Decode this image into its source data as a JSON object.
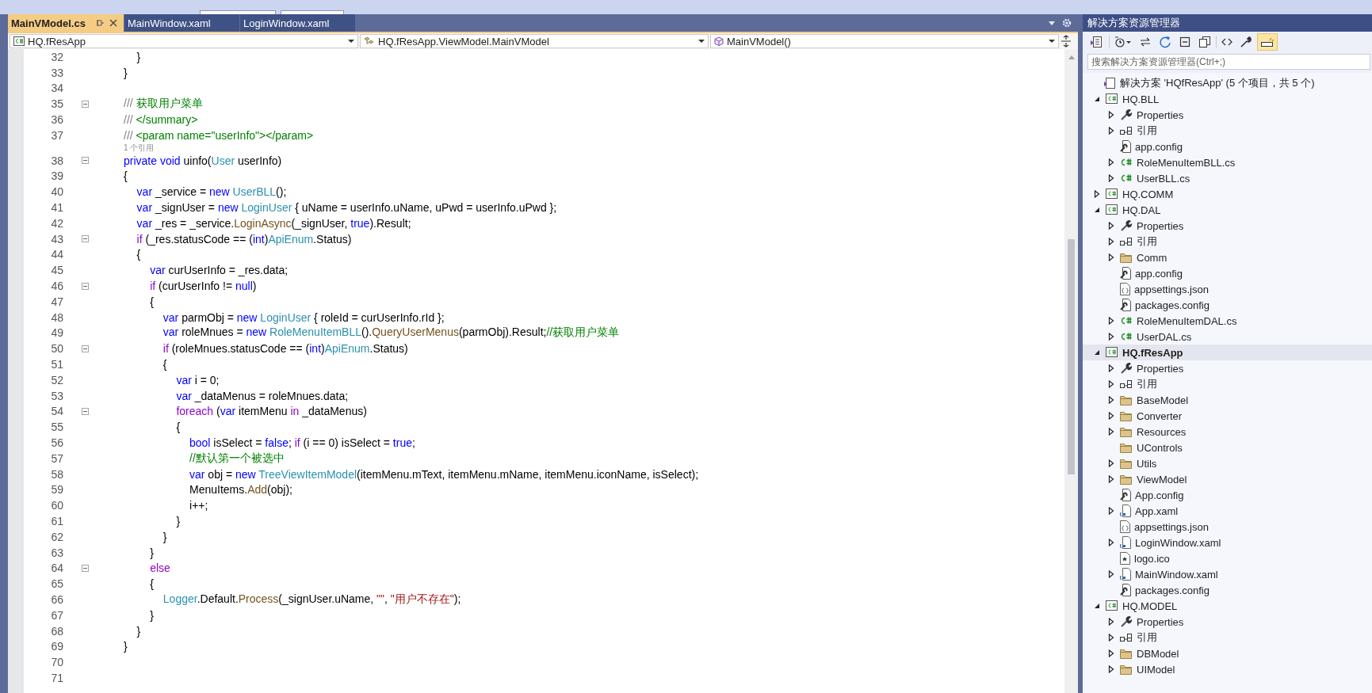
{
  "editor_tabs": [
    {
      "label": "MainVModel.cs",
      "selected": true,
      "pinned": true
    },
    {
      "label": "MainWindow.xaml",
      "selected": false,
      "pinned": false
    },
    {
      "label": "LoginWindow.xaml",
      "selected": false,
      "pinned": false
    }
  ],
  "navigation": {
    "project": "HQ.fResApp",
    "type": "HQ.fResApp.ViewModel.MainVModel",
    "member": "MainVModel()"
  },
  "code_lines": [
    {
      "number": "32",
      "foldable": false,
      "tokens": [
        {
          "kind": "plain",
          "text": "\t}"
        }
      ]
    },
    {
      "number": "33",
      "foldable": false,
      "tokens": [
        {
          "kind": "plain",
          "text": "}"
        }
      ]
    },
    {
      "number": "34",
      "foldable": false
    },
    {
      "number": "35",
      "foldable": true,
      "tokens": [
        {
          "kind": "doc",
          "text": "///"
        },
        {
          "kind": "comment",
          "text": " 获取用户菜单"
        }
      ]
    },
    {
      "number": "36",
      "foldable": false,
      "tokens": [
        {
          "kind": "doc",
          "text": "///"
        },
        {
          "kind": "comment",
          "text": " </summary>"
        }
      ]
    },
    {
      "number": "37",
      "foldable": false,
      "tokens": [
        {
          "kind": "doc",
          "text": "///"
        },
        {
          "kind": "comment",
          "text": " <param name=\"userInfo\"></param>"
        }
      ]
    },
    {
      "kind": "hint",
      "text": "1 个引用"
    },
    {
      "number": "38",
      "foldable": true,
      "tokens": [
        {
          "kind": "kw",
          "text": "private void"
        },
        {
          "kind": "plain",
          "text": " uinfo("
        },
        {
          "kind": "type",
          "text": "User"
        },
        {
          "kind": "plain",
          "text": " userInfo)"
        }
      ]
    },
    {
      "number": "39",
      "foldable": false,
      "tokens": [
        {
          "kind": "plain",
          "text": "{"
        }
      ]
    },
    {
      "number": "40",
      "foldable": false,
      "tokens": [
        {
          "kind": "kw",
          "text": "\tvar"
        },
        {
          "kind": "plain",
          "text": " _service = "
        },
        {
          "kind": "kw",
          "text": "new"
        },
        {
          "kind": "type",
          "text": " UserBLL"
        },
        {
          "kind": "plain",
          "text": "();"
        }
      ]
    },
    {
      "number": "41",
      "foldable": false,
      "tokens": [
        {
          "kind": "kw",
          "text": "\tvar"
        },
        {
          "kind": "plain",
          "text": " _signUser = "
        },
        {
          "kind": "kw",
          "text": "new"
        },
        {
          "kind": "type",
          "text": " LoginUser"
        },
        {
          "kind": "plain",
          "text": " { uName = userInfo.uName, uPwd = userInfo.uPwd };"
        }
      ]
    },
    {
      "number": "42",
      "foldable": false,
      "tokens": [
        {
          "kind": "kw",
          "text": "\tvar"
        },
        {
          "kind": "plain",
          "text": " _res = _service."
        },
        {
          "kind": "method",
          "text": "LoginAsync"
        },
        {
          "kind": "plain",
          "text": "(_signUser, "
        },
        {
          "kind": "kw",
          "text": "true"
        },
        {
          "kind": "plain",
          "text": ").Result;"
        }
      ]
    },
    {
      "number": "43",
      "foldable": true,
      "tokens": [
        {
          "kind": "ctl",
          "text": "\tif"
        },
        {
          "kind": "plain",
          "text": " (_res.statusCode == ("
        },
        {
          "kind": "kw",
          "text": "int"
        },
        {
          "kind": "plain",
          "text": ")"
        },
        {
          "kind": "type",
          "text": "ApiEnum"
        },
        {
          "kind": "plain",
          "text": ".Status)"
        }
      ]
    },
    {
      "number": "44",
      "foldable": false,
      "tokens": [
        {
          "kind": "plain",
          "text": "\t{"
        }
      ]
    },
    {
      "number": "45",
      "foldable": false,
      "tokens": [
        {
          "kind": "kw",
          "text": "\t\tvar"
        },
        {
          "kind": "plain",
          "text": " curUserInfo = _res.data;"
        }
      ]
    },
    {
      "number": "46",
      "foldable": true,
      "tokens": [
        {
          "kind": "ctl",
          "text": "\t\tif"
        },
        {
          "kind": "plain",
          "text": " (curUserInfo != "
        },
        {
          "kind": "kw",
          "text": "null"
        },
        {
          "kind": "plain",
          "text": ")"
        }
      ]
    },
    {
      "number": "47",
      "foldable": false,
      "tokens": [
        {
          "kind": "plain",
          "text": "\t\t{"
        }
      ]
    },
    {
      "number": "48",
      "foldable": false,
      "tokens": [
        {
          "kind": "kw",
          "text": "\t\t\tvar"
        },
        {
          "kind": "plain",
          "text": " parmObj = "
        },
        {
          "kind": "kw",
          "text": "new"
        },
        {
          "kind": "type",
          "text": " LoginUser"
        },
        {
          "kind": "plain",
          "text": " { roleId = curUserInfo.rId };"
        }
      ]
    },
    {
      "number": "49",
      "foldable": false,
      "tokens": [
        {
          "kind": "kw",
          "text": "\t\t\tvar"
        },
        {
          "kind": "plain",
          "text": " roleMnues = "
        },
        {
          "kind": "kw",
          "text": "new"
        },
        {
          "kind": "type",
          "text": " RoleMenuItemBLL"
        },
        {
          "kind": "plain",
          "text": "()."
        },
        {
          "kind": "method",
          "text": "QueryUserMenus"
        },
        {
          "kind": "plain",
          "text": "(parmObj).Result;"
        },
        {
          "kind": "comment",
          "text": "//获取用户菜单"
        }
      ]
    },
    {
      "number": "50",
      "foldable": true,
      "tokens": [
        {
          "kind": "ctl",
          "text": "\t\t\tif"
        },
        {
          "kind": "plain",
          "text": " (roleMnues.statusCode == ("
        },
        {
          "kind": "kw",
          "text": "int"
        },
        {
          "kind": "plain",
          "text": ")"
        },
        {
          "kind": "type",
          "text": "ApiEnum"
        },
        {
          "kind": "plain",
          "text": ".Status)"
        }
      ]
    },
    {
      "number": "51",
      "foldable": false,
      "tokens": [
        {
          "kind": "plain",
          "text": "\t\t\t{"
        }
      ]
    },
    {
      "number": "52",
      "foldable": false,
      "tokens": [
        {
          "kind": "kw",
          "text": "\t\t\t\tvar"
        },
        {
          "kind": "plain",
          "text": " i = 0;"
        }
      ]
    },
    {
      "number": "53",
      "foldable": false,
      "tokens": [
        {
          "kind": "kw",
          "text": "\t\t\t\tvar"
        },
        {
          "kind": "plain",
          "text": " _dataMenus = roleMnues.data;"
        }
      ]
    },
    {
      "number": "54",
      "foldable": true,
      "tokens": [
        {
          "kind": "ctl",
          "text": "\t\t\t\tforeach"
        },
        {
          "kind": "plain",
          "text": " ("
        },
        {
          "kind": "kw",
          "text": "var"
        },
        {
          "kind": "plain",
          "text": " itemMenu "
        },
        {
          "kind": "ctl",
          "text": "in"
        },
        {
          "kind": "plain",
          "text": " _dataMenus)"
        }
      ]
    },
    {
      "number": "55",
      "foldable": false,
      "tokens": [
        {
          "kind": "plain",
          "text": "\t\t\t\t{"
        }
      ]
    },
    {
      "number": "56",
      "foldable": false,
      "tokens": [
        {
          "kind": "kw",
          "text": "\t\t\t\t\tbool"
        },
        {
          "kind": "plain",
          "text": " isSelect = "
        },
        {
          "kind": "kw",
          "text": "false"
        },
        {
          "kind": "plain",
          "text": "; "
        },
        {
          "kind": "ctl",
          "text": "if"
        },
        {
          "kind": "plain",
          "text": " (i == 0) isSelect = "
        },
        {
          "kind": "kw",
          "text": "true"
        },
        {
          "kind": "plain",
          "text": ";"
        }
      ]
    },
    {
      "number": "57",
      "foldable": false,
      "tokens": [
        {
          "kind": "comment",
          "text": "\t\t\t\t\t//默认第一个被选中"
        }
      ]
    },
    {
      "number": "58",
      "foldable": false,
      "tokens": [
        {
          "kind": "kw",
          "text": "\t\t\t\t\tvar"
        },
        {
          "kind": "plain",
          "text": " obj = "
        },
        {
          "kind": "kw",
          "text": "new"
        },
        {
          "kind": "type",
          "text": " TreeViewItemModel"
        },
        {
          "kind": "plain",
          "text": "(itemMenu.mText, itemMenu.mName, itemMenu.iconName, isSelect);"
        }
      ]
    },
    {
      "number": "59",
      "foldable": false,
      "tokens": [
        {
          "kind": "plain",
          "text": "\t\t\t\t\tMenuItems."
        },
        {
          "kind": "method",
          "text": "Add"
        },
        {
          "kind": "plain",
          "text": "(obj);"
        }
      ]
    },
    {
      "number": "60",
      "foldable": false,
      "tokens": [
        {
          "kind": "plain",
          "text": "\t\t\t\t\ti++;"
        }
      ]
    },
    {
      "number": "61",
      "foldable": false,
      "tokens": [
        {
          "kind": "plain",
          "text": "\t\t\t\t}"
        }
      ]
    },
    {
      "number": "62",
      "foldable": false,
      "tokens": [
        {
          "kind": "plain",
          "text": "\t\t\t}"
        }
      ]
    },
    {
      "number": "63",
      "foldable": false,
      "tokens": [
        {
          "kind": "plain",
          "text": "\t\t}"
        }
      ]
    },
    {
      "number": "64",
      "foldable": true,
      "tokens": [
        {
          "kind": "ctl",
          "text": "\t\telse"
        }
      ]
    },
    {
      "number": "65",
      "foldable": false,
      "tokens": [
        {
          "kind": "plain",
          "text": "\t\t{"
        }
      ]
    },
    {
      "number": "66",
      "foldable": false,
      "tokens": [
        {
          "kind": "type",
          "text": "\t\t\tLogger"
        },
        {
          "kind": "plain",
          "text": ".Default."
        },
        {
          "kind": "method",
          "text": "Process"
        },
        {
          "kind": "plain",
          "text": "(_signUser.uName, "
        },
        {
          "kind": "string",
          "text": "\"\""
        },
        {
          "kind": "plain",
          "text": ", "
        },
        {
          "kind": "string",
          "text": "\"用户不存在\""
        },
        {
          "kind": "plain",
          "text": ");"
        }
      ]
    },
    {
      "number": "67",
      "foldable": false,
      "tokens": [
        {
          "kind": "plain",
          "text": "\t\t}"
        }
      ]
    },
    {
      "number": "68",
      "foldable": false,
      "tokens": [
        {
          "kind": "plain",
          "text": "\t}"
        }
      ]
    },
    {
      "number": "69",
      "foldable": false,
      "tokens": [
        {
          "kind": "plain",
          "text": "}"
        }
      ]
    },
    {
      "number": "70",
      "foldable": false
    },
    {
      "number": "71",
      "foldable": false
    }
  ],
  "solution_explorer": {
    "title": "解决方案资源管理器",
    "toolbar_buttons": [
      {
        "pressed": false
      },
      {
        "pressed": false
      },
      {
        "pressed": false
      },
      {
        "pressed": false
      },
      {
        "pressed": false
      },
      {
        "pressed": false
      },
      {
        "pressed": false
      },
      {
        "pressed": false
      },
      {
        "pressed": true
      }
    ],
    "search": {
      "placeholder": "搜索解决方案资源管理器(Ctrl+;)"
    },
    "tree": {
      "label": "解决方案 'HQfResApp' (5 个项目，共 5 个)",
      "kind": "solution",
      "children": [
        {
          "label": "HQ.BLL",
          "kind": "project",
          "expandable": true,
          "expanded": true,
          "selected": false,
          "startup": false,
          "children": [
            {
              "label": "Properties",
              "kind": "wrench",
              "expandable": true,
              "expanded": false,
              "selected": false
            },
            {
              "label": "引用",
              "kind": "refs",
              "expandable": true,
              "expanded": false,
              "selected": false
            },
            {
              "label": "app.config",
              "kind": "config",
              "expandable": false,
              "selected": false
            },
            {
              "label": "RoleMenuItemBLL.cs",
              "kind": "cs",
              "expandable": true,
              "expanded": false,
              "selected": false
            },
            {
              "label": "UserBLL.cs",
              "kind": "cs",
              "expandable": true,
              "expanded": false,
              "selected": false
            }
          ]
        },
        {
          "label": "HQ.COMM",
          "kind": "project",
          "expandable": true,
          "expanded": false,
          "selected": false,
          "startup": false
        },
        {
          "label": "HQ.DAL",
          "kind": "project",
          "expandable": true,
          "expanded": true,
          "selected": false,
          "startup": false,
          "children": [
            {
              "label": "Properties",
              "kind": "wrench",
              "expandable": true,
              "expanded": false,
              "selected": false
            },
            {
              "label": "引用",
              "kind": "refs",
              "expandable": true,
              "expanded": false,
              "selected": false
            },
            {
              "label": "Comm",
              "kind": "folder",
              "expandable": true,
              "expanded": false,
              "selected": false
            },
            {
              "label": "app.config",
              "kind": "config",
              "expandable": false,
              "selected": false
            },
            {
              "label": "appsettings.json",
              "kind": "json",
              "expandable": false,
              "selected": false
            },
            {
              "label": "packages.config",
              "kind": "config",
              "expandable": false,
              "selected": false
            },
            {
              "label": "RoleMenuItemDAL.cs",
              "kind": "cs",
              "expandable": true,
              "expanded": false,
              "selected": false
            },
            {
              "label": "UserDAL.cs",
              "kind": "cs",
              "expandable": true,
              "expanded": false,
              "selected": false
            }
          ]
        },
        {
          "label": "HQ.fResApp",
          "kind": "project",
          "expandable": true,
          "expanded": true,
          "selected": true,
          "startup": true,
          "children": [
            {
              "label": "Properties",
              "kind": "wrench",
              "expandable": true,
              "expanded": false,
              "selected": false
            },
            {
              "label": "引用",
              "kind": "refs",
              "expandable": true,
              "expanded": false,
              "selected": false
            },
            {
              "label": "BaseModel",
              "kind": "folder",
              "expandable": true,
              "expanded": false,
              "selected": false
            },
            {
              "label": "Converter",
              "kind": "folder",
              "expandable": true,
              "expanded": false,
              "selected": false
            },
            {
              "label": "Resources",
              "kind": "folder",
              "expandable": true,
              "expanded": false,
              "selected": false
            },
            {
              "label": "UControls",
              "kind": "folder",
              "expandable": false,
              "selected": false
            },
            {
              "label": "Utils",
              "kind": "folder",
              "expandable": true,
              "expanded": false,
              "selected": false
            },
            {
              "label": "ViewModel",
              "kind": "folder",
              "expandable": true,
              "expanded": false,
              "selected": false
            },
            {
              "label": "App.config",
              "kind": "config",
              "expandable": false,
              "selected": false
            },
            {
              "label": "App.xaml",
              "kind": "xaml",
              "expandable": true,
              "expanded": false,
              "selected": false
            },
            {
              "label": "appsettings.json",
              "kind": "json",
              "expandable": false,
              "selected": false
            },
            {
              "label": "LoginWindow.xaml",
              "kind": "xaml",
              "expandable": true,
              "expanded": false,
              "selected": false
            },
            {
              "label": "logo.ico",
              "kind": "ico",
              "expandable": false,
              "selected": false
            },
            {
              "label": "MainWindow.xaml",
              "kind": "xaml",
              "expandable": true,
              "expanded": false,
              "selected": false
            },
            {
              "label": "packages.config",
              "kind": "config",
              "expandable": false,
              "selected": false
            }
          ]
        },
        {
          "label": "HQ.MODEL",
          "kind": "project",
          "expandable": true,
          "expanded": true,
          "selected": false,
          "startup": false,
          "children": [
            {
              "label": "Properties",
              "kind": "wrench",
              "expandable": true,
              "expanded": false,
              "selected": false
            },
            {
              "label": "引用",
              "kind": "refs",
              "expandable": true,
              "expanded": false,
              "selected": false
            },
            {
              "label": "DBModel",
              "kind": "folder",
              "expandable": true,
              "expanded": false,
              "selected": false
            },
            {
              "label": "UIModel",
              "kind": "folder",
              "expandable": true,
              "expanded": false,
              "selected": false
            }
          ]
        }
      ]
    }
  }
}
